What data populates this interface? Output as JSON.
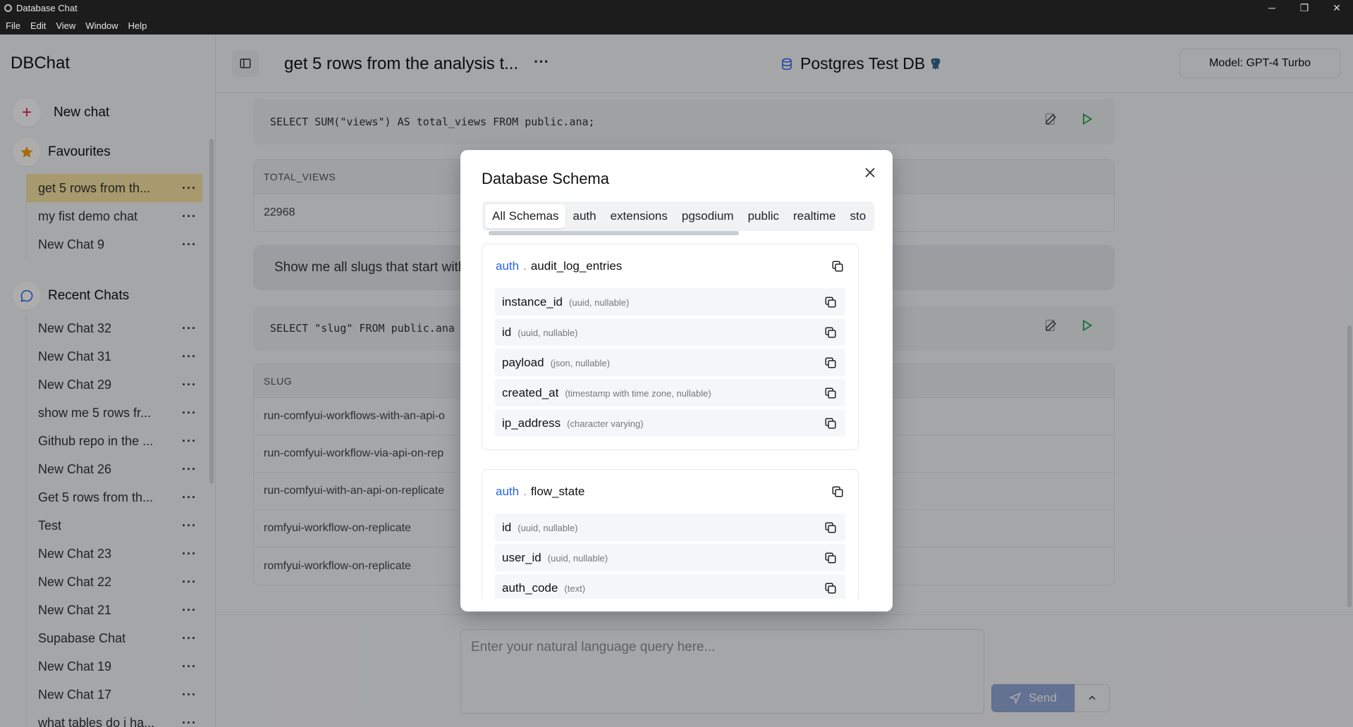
{
  "window": {
    "title": "Database Chat",
    "menu": [
      "File",
      "Edit",
      "View",
      "Window",
      "Help"
    ],
    "controls": {
      "minimize": "─",
      "maximize": "❐",
      "close": "✕"
    }
  },
  "sidebar": {
    "brand": "DBChat",
    "new_chat_label": "New chat",
    "favourites_label": "Favourites",
    "favourites": [
      {
        "label": "get 5 rows from th...",
        "active": true
      },
      {
        "label": "my fist demo chat",
        "active": false
      },
      {
        "label": "New Chat 9",
        "active": false
      }
    ],
    "recent_label": "Recent Chats",
    "recent": [
      "New Chat 32",
      "New Chat 31",
      "New Chat 29",
      "show me 5 rows fr...",
      "Github repo in the ...",
      "New Chat 26",
      "Get 5 rows from th...",
      "Test",
      "New Chat 23",
      "New Chat 22",
      "New Chat 21",
      "Supabase Chat",
      "New Chat 19",
      "New Chat 17",
      "what tables do i ha..."
    ],
    "item_menu": "···"
  },
  "header": {
    "chat_title": "get 5 rows from the analysis t...",
    "title_menu": "···",
    "db_name": "Postgres Test DB",
    "model_label": "Model: GPT-4 Turbo"
  },
  "main": {
    "query1": "SELECT SUM(\"views\") AS total_views FROM public.ana;",
    "result1": {
      "header": "TOTAL_VIEWS",
      "rows": [
        "22968"
      ]
    },
    "user_message": "Show me all slugs that start with",
    "query2": "SELECT \"slug\" FROM public.ana",
    "result2": {
      "header": "SLUG",
      "rows": [
        "run-comfyui-workflows-with-an-api-o",
        "run-comfyui-workflow-via-api-on-rep",
        "run-comfyui-with-an-api-on-replicate",
        "romfyui-workflow-on-replicate",
        "romfyui-workflow-on-replicate"
      ]
    }
  },
  "input": {
    "placeholder": "Enter your natural language query here...",
    "send_label": "Send"
  },
  "modal": {
    "title": "Database Schema",
    "tabs": [
      "All Schemas",
      "auth",
      "extensions",
      "pgsodium",
      "public",
      "realtime",
      "sto"
    ],
    "active_tab": "All Schemas",
    "tables": [
      {
        "schema": "auth",
        "name": "audit_log_entries",
        "columns": [
          {
            "name": "instance_id",
            "type": "(uuid, nullable)"
          },
          {
            "name": "id",
            "type": "(uuid, nullable)"
          },
          {
            "name": "payload",
            "type": "(json, nullable)"
          },
          {
            "name": "created_at",
            "type": "(timestamp with time zone, nullable)"
          },
          {
            "name": "ip_address",
            "type": "(character varying)"
          }
        ]
      },
      {
        "schema": "auth",
        "name": "flow_state",
        "columns": [
          {
            "name": "id",
            "type": "(uuid, nullable)"
          },
          {
            "name": "user_id",
            "type": "(uuid, nullable)"
          },
          {
            "name": "auth_code",
            "type": "(text)"
          }
        ]
      }
    ]
  },
  "colors": {
    "accent_active": "#f7e3a3",
    "schema_link": "#2563eb",
    "send_button": "#93a7d8",
    "run_icon": "#16a34a",
    "new_chat_plus": "#e11d48",
    "favourites_star": "#f59e0b"
  }
}
